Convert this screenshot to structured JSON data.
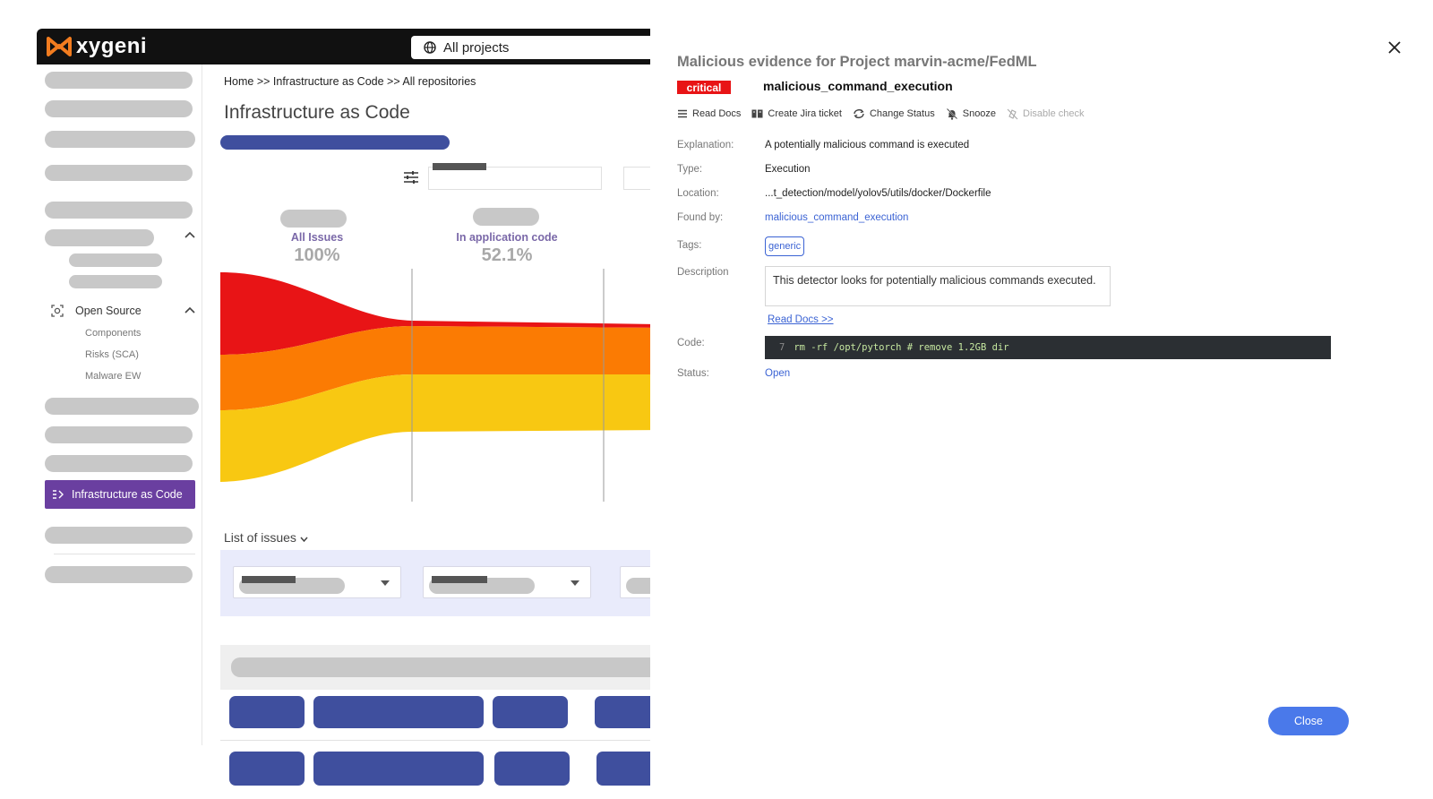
{
  "app": {
    "logo_text": "xygeni",
    "project_selector": "All projects"
  },
  "sidebar": {
    "open_source_label": "Open Source",
    "sub_items": [
      "Components",
      "Risks (SCA)",
      "Malware EW"
    ],
    "active_item": "Infrastructure as Code"
  },
  "main": {
    "breadcrumb": "Home >> Infrastructure as Code >> All repositories",
    "title": "Infrastructure as Code",
    "flow_columns": [
      {
        "label": "All Issues",
        "percent": "100%"
      },
      {
        "label": "In application code",
        "percent": "52.1%"
      }
    ],
    "list_title": "List of issues"
  },
  "colors": {
    "critical": "#e81416",
    "high": "#fb7b03",
    "medium": "#f8c812",
    "brand_purple": "#6a3fa0",
    "skeleton_blue": "#3f4f9e",
    "link": "#3b63d4"
  },
  "panel": {
    "title": "Malicious evidence for Project marvin-acme/FedML",
    "severity": "critical",
    "check_name": "malicious_command_execution",
    "actions": [
      {
        "label": "Read Docs",
        "icon": "list-icon",
        "enabled": true
      },
      {
        "label": "Create Jira ticket",
        "icon": "jira-icon",
        "enabled": true
      },
      {
        "label": "Change Status",
        "icon": "refresh-icon",
        "enabled": true
      },
      {
        "label": "Snooze",
        "icon": "bell-off-icon",
        "enabled": true
      },
      {
        "label": "Disable check",
        "icon": "disable-icon",
        "enabled": false
      }
    ],
    "fields": {
      "explanation_label": "Explanation:",
      "explanation": "A potentially malicious command is executed",
      "type_label": "Type:",
      "type": "Execution",
      "location_label": "Location:",
      "location": "...t_detection/model/yolov5/utils/docker/Dockerfile",
      "found_by_label": "Found by:",
      "found_by": "malicious_command_execution",
      "tags_label": "Tags:",
      "tag": "generic",
      "description_label": "Description",
      "description": "This detector looks for potentially malicious commands executed.",
      "read_docs_link": "Read Docs >>",
      "code_label": "Code:",
      "code_line_number": "7",
      "code": "rm -rf /opt/pytorch # remove 1.2GB dir",
      "status_label": "Status:",
      "status": "Open"
    },
    "close_button": "Close"
  }
}
